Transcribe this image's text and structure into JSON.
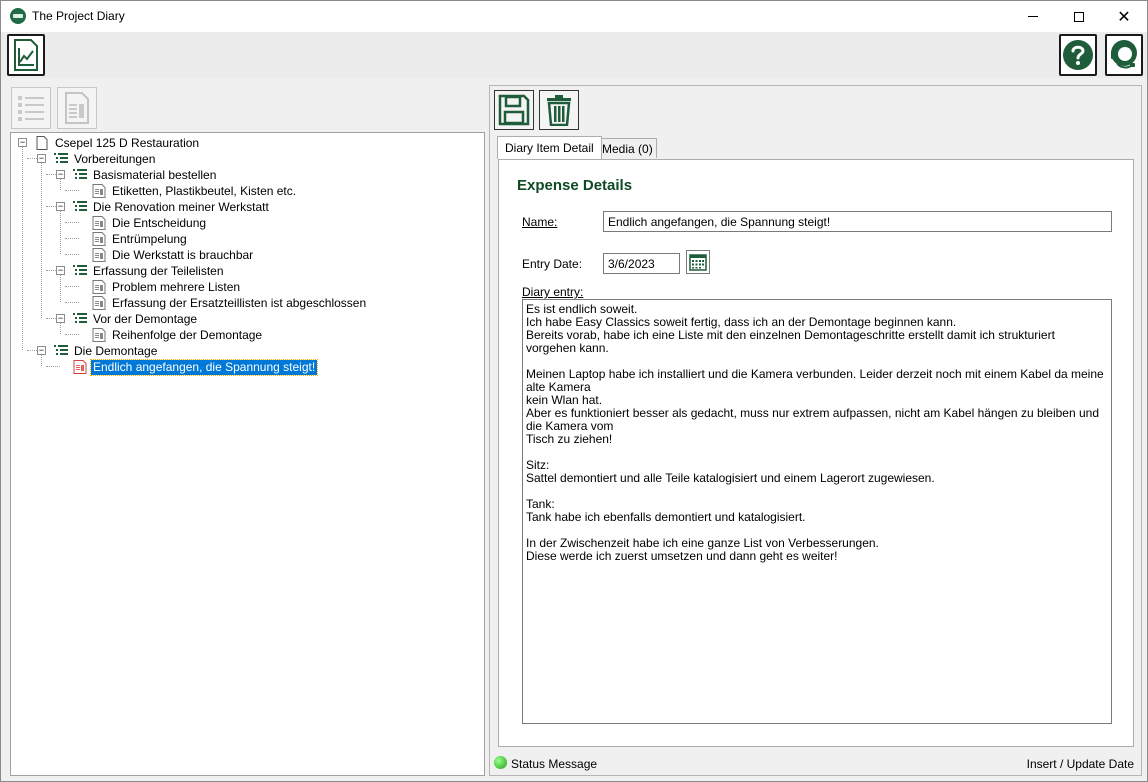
{
  "window": {
    "title": "The Project Diary",
    "minimize_label": "",
    "close_label": "✕"
  },
  "tree": {
    "nodes": [
      {
        "label": "Csepel 125 D Restauration"
      },
      {
        "label": "Vorbereitungen"
      },
      {
        "label": "Basismaterial bestellen"
      },
      {
        "label": "Etiketten, Plastikbeutel, Kisten etc."
      },
      {
        "label": "Die Renovation meiner Werkstatt"
      },
      {
        "label": "Die Entscheidung"
      },
      {
        "label": "Entrümpelung"
      },
      {
        "label": "Die Werkstatt is brauchbar"
      },
      {
        "label": "Erfassung der Teilelisten"
      },
      {
        "label": "Problem mehrere Listen"
      },
      {
        "label": "Erfassung der Ersatzteillisten ist abgeschlossen"
      },
      {
        "label": "Vor der Demontage"
      },
      {
        "label": "Reihenfolge der Demontage"
      },
      {
        "label": "Die Demontage"
      },
      {
        "label": "Endlich angefangen, die Spannung steigt!"
      }
    ]
  },
  "tabs": {
    "detail": "Diary Item Detail",
    "media": "Media (0)"
  },
  "form": {
    "section_title": "Expense Details",
    "name_label": "Name:",
    "name_value": "Endlich angefangen, die Spannung steigt!",
    "date_label": "Entry Date:",
    "date_value": "3/6/2023",
    "entry_label": "Diary entry:",
    "entry_lines": [
      "Es ist endlich soweit.",
      "Ich habe Easy Classics soweit fertig, dass ich an der Demontage beginnen kann.",
      "Bereits vorab, habe ich eine Liste mit den einzelnen Demontageschritte erstellt damit ich strukturiert vorgehen kann.",
      "",
      "Meinen Laptop habe ich installiert und die Kamera verbunden. Leider derzeit noch mit einem Kabel da meine alte Kamera",
      "kein Wlan hat.",
      "Aber es funktioniert besser als gedacht, muss nur extrem aufpassen, nicht am Kabel hängen zu bleiben und die Kamera vom",
      "Tisch zu ziehen!",
      "",
      "Sitz:",
      "Sattel demontiert und alle Teile katalogisiert und einem Lagerort zugewiesen.",
      "",
      "Tank:",
      "Tank habe ich ebenfalls demontiert und katalogisiert.",
      "",
      "In der Zwischenzeit habe ich eine ganze List von Verbesserungen.",
      "Diese werde ich zuerst umsetzen und dann geht es weiter!"
    ]
  },
  "status": {
    "message": "Status Message",
    "right": "Insert / Update Date"
  },
  "colors": {
    "accent_green": "#0f4a25",
    "selection_blue": "#0078d7",
    "status_green": "#1ea012",
    "media_red": "#c40000"
  }
}
